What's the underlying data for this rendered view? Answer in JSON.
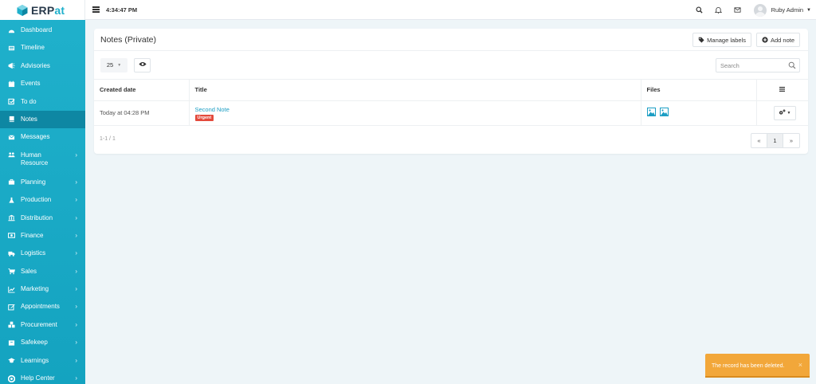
{
  "brand": {
    "name_prefix": "ERP",
    "name_suffix": "at",
    "accent": "#1fb0cc"
  },
  "topbar": {
    "time": "4:34:47 PM",
    "user_name": "Ruby Admin",
    "icons": [
      "menu-icon",
      "search-icon",
      "bell-icon",
      "mail-icon",
      "avatar"
    ]
  },
  "sidebar": {
    "items": [
      {
        "label": "Dashboard",
        "icon": "dashboard-icon",
        "has_submenu": false
      },
      {
        "label": "Timeline",
        "icon": "timeline-icon",
        "has_submenu": false
      },
      {
        "label": "Advisories",
        "icon": "bullhorn-icon",
        "has_submenu": false
      },
      {
        "label": "Events",
        "icon": "calendar-icon",
        "has_submenu": false
      },
      {
        "label": "To do",
        "icon": "checkbox-icon",
        "has_submenu": false
      },
      {
        "label": "Notes",
        "icon": "book-icon",
        "has_submenu": false,
        "active": true
      },
      {
        "label": "Messages",
        "icon": "envelope-icon",
        "has_submenu": false
      },
      {
        "label": "Human Resource",
        "icon": "users-icon",
        "has_submenu": true
      },
      {
        "label": "Planning",
        "icon": "briefcase-icon",
        "has_submenu": true
      },
      {
        "label": "Production",
        "icon": "flask-icon",
        "has_submenu": true
      },
      {
        "label": "Distribution",
        "icon": "bank-icon",
        "has_submenu": true
      },
      {
        "label": "Finance",
        "icon": "money-icon",
        "has_submenu": true
      },
      {
        "label": "Logistics",
        "icon": "truck-icon",
        "has_submenu": true
      },
      {
        "label": "Sales",
        "icon": "cart-icon",
        "has_submenu": true
      },
      {
        "label": "Marketing",
        "icon": "chart-icon",
        "has_submenu": true
      },
      {
        "label": "Appointments",
        "icon": "edit-icon",
        "has_submenu": true
      },
      {
        "label": "Procurement",
        "icon": "cubes-icon",
        "has_submenu": true
      },
      {
        "label": "Safekeep",
        "icon": "archive-icon",
        "has_submenu": true
      },
      {
        "label": "Learnings",
        "icon": "graduation-icon",
        "has_submenu": true
      },
      {
        "label": "Help Center",
        "icon": "help-icon",
        "has_submenu": true
      }
    ]
  },
  "panel": {
    "title": "Notes (Private)",
    "manage_labels": "Manage labels",
    "add_note": "Add note",
    "page_size": "25",
    "search_placeholder": "Search",
    "columns": {
      "created": "Created date",
      "title": "Title",
      "files": "Files"
    },
    "rows": [
      {
        "created": "Today at 04:28 PM",
        "title": "Second Note",
        "label": "Urgent",
        "file_count": 2
      }
    ],
    "info": "1-1 / 1",
    "pager": {
      "prev": "«",
      "page": "1",
      "next": "»"
    }
  },
  "toast": {
    "message": "The record has been deleted.",
    "close": "×"
  },
  "colors": {
    "sidebar": "#1aaac6",
    "active": "#0e87a3",
    "link": "#1c9ec4",
    "badge": "#e34a3c",
    "toast": "#f2a73a"
  }
}
